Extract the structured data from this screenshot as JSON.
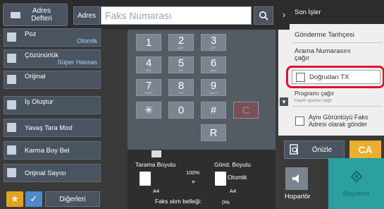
{
  "header": {
    "address_book": "Adres\nDefteri",
    "address": "Adres",
    "fax_placeholder": "Faks Numarası"
  },
  "left_menu": [
    {
      "label": "Poz",
      "value": "Otomtk"
    },
    {
      "label": "Çözünürlük",
      "value": "Süper Hassas"
    },
    {
      "label": "Orijinal",
      "value": ""
    },
    {
      "label": "İş Oluştur",
      "value": ""
    },
    {
      "label": "Yavaş Tara Mod",
      "value": ""
    },
    {
      "label": "Karma Boy Bel",
      "value": ""
    },
    {
      "label": "Orijinal Sayısı",
      "value": ""
    }
  ],
  "bottom_left": {
    "others": "Diğerleri",
    "star": "★",
    "check": "✓"
  },
  "keypad": {
    "keys": [
      {
        "n": "1",
        "s": ""
      },
      {
        "n": "2",
        "s": "ABC"
      },
      {
        "n": "3",
        "s": "DEF"
      },
      {
        "n": "4",
        "s": "GHI"
      },
      {
        "n": "5",
        "s": "JKL"
      },
      {
        "n": "6",
        "s": "MNO"
      },
      {
        "n": "7",
        "s": "PQRS"
      },
      {
        "n": "8",
        "s": "TUV"
      },
      {
        "n": "9",
        "s": "WXYZ"
      },
      {
        "n": "✳",
        "s": ""
      },
      {
        "n": "0",
        "s": ""
      },
      {
        "n": "#",
        "s": ""
      },
      {
        "n": "C",
        "s": ""
      },
      {
        "n": "R",
        "s": ""
      }
    ]
  },
  "scan": {
    "scan_size_label": "Tarama Boyutu",
    "send_size_label": "Gönd. Boyutu",
    "ratio": "100%",
    "send_size_value": "Otomtk",
    "scan_size_paper": "A4",
    "send_size_paper": "A4",
    "fax_memory_label": "Faks alım belleği:",
    "fax_memory_value": "0%"
  },
  "right_panel": {
    "recent_jobs": "Son İşler",
    "send_history": "Gönderme Tarihçesi",
    "call_number": "Arama Numarasını\nçağır",
    "direct_tx": "Doğrudan TX",
    "program_call": "Programı çağır",
    "saved_settings": "Kayıtlı ayarları çağır",
    "same_image_fax": "Aynı Görüntüyü Faks\nAdresi olarak gönder"
  },
  "bottom_right": {
    "preview": "Önizle",
    "ca": "CA",
    "speaker": "Hoparlör",
    "start": "Başlatma"
  },
  "colors": {
    "accent_red": "#e0122b",
    "ca_yellow": "#ebaf2e",
    "start_teal": "#2aa0a0",
    "star_orange": "#e3a221"
  }
}
